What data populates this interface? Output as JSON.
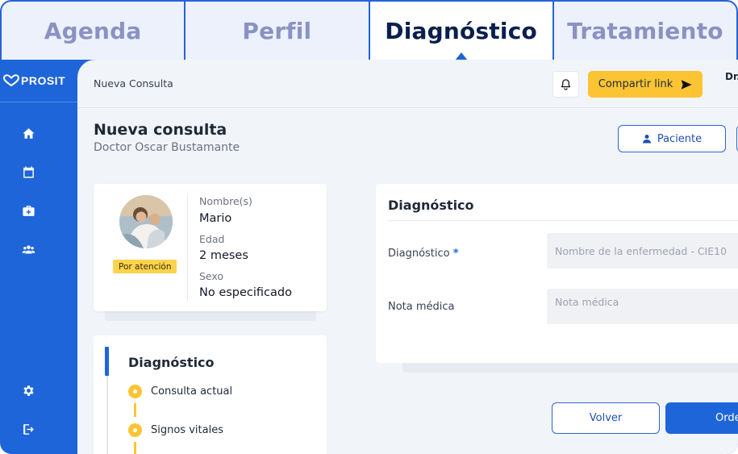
{
  "tabs": [
    {
      "label": "Agenda",
      "active": false
    },
    {
      "label": "Perfil",
      "active": false
    },
    {
      "label": "Diagnóstico",
      "active": true
    },
    {
      "label": "Tratamiento",
      "active": false
    }
  ],
  "brand": {
    "name": "PROSIT"
  },
  "colors": {
    "primary": "#1e65d9",
    "accent": "#fcc433",
    "background": "#f1f4f9"
  },
  "sidebar": {
    "items": [
      {
        "icon": "home-icon"
      },
      {
        "icon": "calendar-icon"
      },
      {
        "icon": "medical-kit-icon"
      },
      {
        "icon": "users-icon"
      }
    ],
    "bottom": [
      {
        "icon": "gear-icon"
      },
      {
        "icon": "logout-icon"
      }
    ]
  },
  "topbar": {
    "breadcrumb": "Nueva Consulta",
    "share_label": "Compartir link",
    "doctor_short": "Dr."
  },
  "page": {
    "title": "Nueva consulta",
    "subtitle": "Doctor Oscar Bustamante",
    "patient_button": "Paciente"
  },
  "patient": {
    "badge": "Por atención",
    "fields": [
      {
        "label": "Nombre(s)",
        "value": "Mario"
      },
      {
        "label": "Edad",
        "value": "2 meses"
      },
      {
        "label": "Sexo",
        "value": "No especificado"
      }
    ]
  },
  "steps": {
    "title": "Diagnóstico",
    "items": [
      {
        "label": "Consulta actual"
      },
      {
        "label": "Signos vitales"
      }
    ]
  },
  "diagnosis_form": {
    "title": "Diagnóstico",
    "diagnosis_label": "Diagnóstico",
    "required_mark": "*",
    "diagnosis_placeholder": "Nombre de la enfermedad - CIE10",
    "note_label": "Nota médica",
    "note_placeholder": "Nota médica"
  },
  "actions": {
    "back_label": "Volver",
    "next_label": "Orde"
  }
}
